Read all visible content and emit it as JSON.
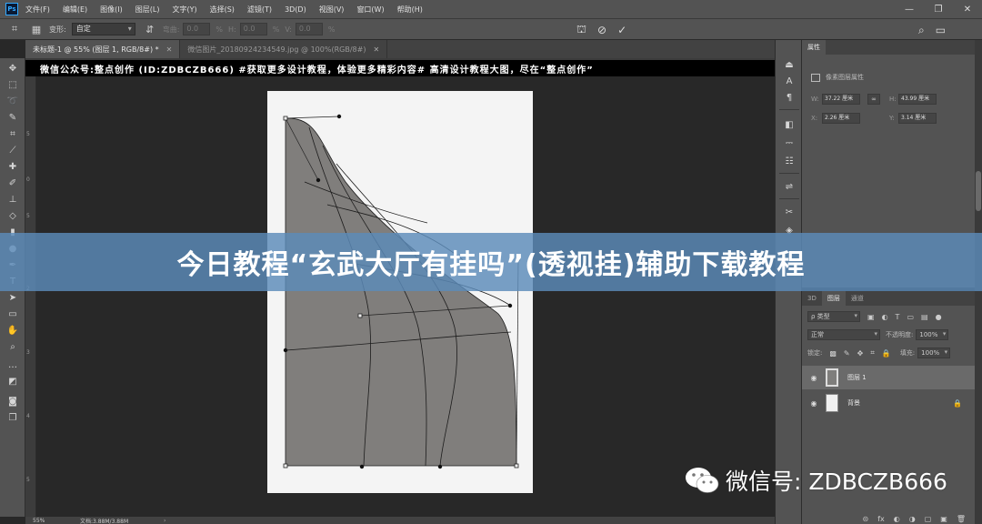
{
  "menubar": {
    "logo": "Ps",
    "items": [
      "文件(F)",
      "编辑(E)",
      "图像(I)",
      "图层(L)",
      "文字(Y)",
      "选择(S)",
      "滤镜(T)",
      "3D(D)",
      "视图(V)",
      "窗口(W)",
      "帮助(H)"
    ],
    "window_controls": [
      "—",
      "❐",
      "✕"
    ]
  },
  "options_bar": {
    "warp_label": "变形:",
    "warp_value": "自定",
    "grid_label": "",
    "percent_unit": "%",
    "h_label": "H:",
    "v_label": "V:",
    "h_value": "0.0",
    "v_value": "0.0",
    "bend_label": "弯曲:",
    "bend_value": "0.0",
    "cancel_glyph": "⊘",
    "commit_glyph": "✓",
    "search_glyph": "⌕",
    "workspace_glyph": "▭"
  },
  "tabs": [
    {
      "label": "未标题-1 @ 55% (图层 1, RGB/8#) *",
      "close": "✕"
    },
    {
      "label": "微信图片_20180924234549.jpg @ 100%(RGB/8#)",
      "close": "✕"
    }
  ],
  "canvas": {
    "watermark_banner": "微信公众号:整点创作 (ID:ZDBCZB666) #获取更多设计教程，体验更多精彩内容#  高清设计教程大图，尽在“整点创作”"
  },
  "statusbar": {
    "zoom": "55%",
    "doc_info": "文档:3.88M/3.88M",
    "arrow": "›"
  },
  "properties": {
    "tab": "属性",
    "subtitle": "像素图层属性",
    "w_label": "W:",
    "w_value": "37.22 厘米",
    "h_label": "H:",
    "h_value": "43.99 厘米",
    "x_label": "X:",
    "x_value": "2.26 厘米",
    "y_label": "Y:",
    "y_value": "3.14 厘米",
    "link_glyph": "∞"
  },
  "layers": {
    "tabs": [
      "3D",
      "图层",
      "通道"
    ],
    "kind_label": "ρ 类型",
    "blend_mode": "正常",
    "opacity_label": "不透明度:",
    "opacity_value": "100%",
    "lock_label": "锁定:",
    "fill_label": "填充:",
    "fill_value": "100%",
    "items": [
      {
        "name": "图层 1",
        "visible_glyph": "◉"
      },
      {
        "name": "背景",
        "visible_glyph": "◉",
        "lock_glyph": "🔒"
      }
    ],
    "footer_glyphs": [
      "⊝",
      "fx",
      "◐",
      "◑",
      "▢",
      "▣",
      "🗑"
    ]
  },
  "overlay": {
    "title": "今日教程“玄武大厅有挂吗”(透视挂)辅助下载教程",
    "wechat": "微信号: ZDBCZB666"
  },
  "colors": {
    "shape_fill": "#807e7c",
    "title_banner": "#5c8bba",
    "ps_accent": "#31a8ff"
  }
}
